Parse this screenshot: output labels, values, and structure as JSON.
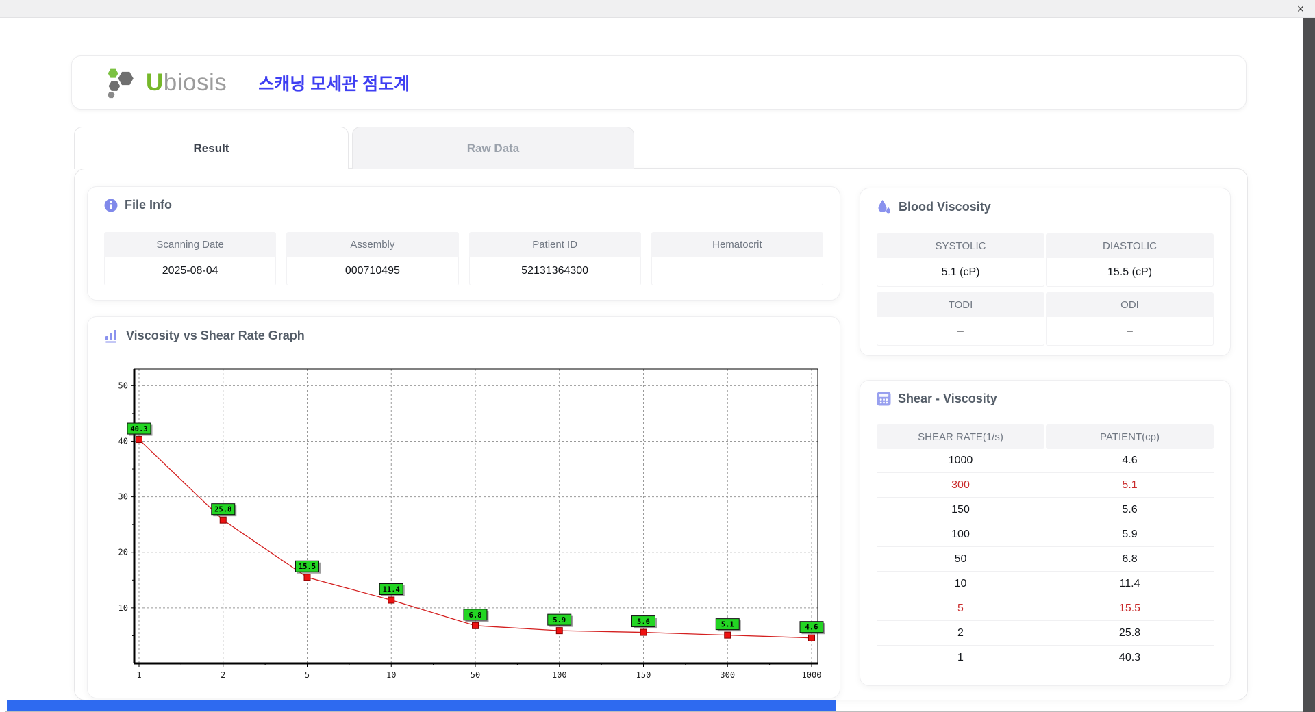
{
  "window": {
    "close_glyph": "×"
  },
  "header": {
    "brand_u": "U",
    "brand_rest": "biosis",
    "app_title": "스캐닝 모세관 점도계"
  },
  "tabs": [
    {
      "label": "Result",
      "active": true
    },
    {
      "label": "Raw Data",
      "active": false
    }
  ],
  "file_info": {
    "title": "File Info",
    "fields": [
      {
        "label": "Scanning Date",
        "value": "2025-08-04"
      },
      {
        "label": "Assembly",
        "value": "000710495"
      },
      {
        "label": "Patient ID",
        "value": "52131364300"
      },
      {
        "label": "Hematocrit",
        "value": ""
      }
    ]
  },
  "blood_viscosity": {
    "title": "Blood Viscosity",
    "rows": [
      {
        "cells": [
          {
            "label": "SYSTOLIC",
            "value": "5.1 (cP)"
          },
          {
            "label": "DIASTOLIC",
            "value": "15.5 (cP)"
          }
        ]
      },
      {
        "cells": [
          {
            "label": "TODI",
            "value": "–"
          },
          {
            "label": "ODI",
            "value": "–"
          }
        ]
      }
    ]
  },
  "shear_viscosity": {
    "title": "Shear - Viscosity",
    "columns": [
      "SHEAR RATE(1/s)",
      "PATIENT(cp)"
    ],
    "rows": [
      {
        "shear_rate": "1000",
        "patient": "4.6",
        "highlight": false
      },
      {
        "shear_rate": "300",
        "patient": "5.1",
        "highlight": true
      },
      {
        "shear_rate": "150",
        "patient": "5.6",
        "highlight": false
      },
      {
        "shear_rate": "100",
        "patient": "5.9",
        "highlight": false
      },
      {
        "shear_rate": "50",
        "patient": "6.8",
        "highlight": false
      },
      {
        "shear_rate": "10",
        "patient": "11.4",
        "highlight": false
      },
      {
        "shear_rate": "5",
        "patient": "15.5",
        "highlight": true
      },
      {
        "shear_rate": "2",
        "patient": "25.8",
        "highlight": false
      },
      {
        "shear_rate": "1",
        "patient": "40.3",
        "highlight": false
      }
    ]
  },
  "chart_data": {
    "type": "line",
    "title": "Viscosity vs Shear Rate Graph",
    "xlabel": "",
    "ylabel": "",
    "x_categories": [
      "1",
      "2",
      "5",
      "10",
      "50",
      "100",
      "150",
      "300",
      "1000"
    ],
    "series": [
      {
        "name": "PATIENT(cp)",
        "values": [
          40.3,
          25.8,
          15.5,
          11.4,
          6.8,
          5.9,
          5.6,
          5.1,
          4.6
        ]
      }
    ],
    "point_labels": [
      "40.3",
      "25.8",
      "15.5",
      "11.4",
      "6.8",
      "5.9",
      "5.6",
      "5.1",
      "4.6"
    ],
    "ylim": [
      0,
      53
    ],
    "yticks": [
      10,
      20,
      30,
      40,
      50
    ],
    "x_axis_scale": "categorical (log-spaced shear rates)",
    "grid": true,
    "legend": "none",
    "line_color": "#d42020",
    "marker_color": "#ee1212",
    "marker_stroke": "#8a0000",
    "label_bg": "#23d523",
    "label_text_color": "#000000"
  },
  "colors": {
    "accent_indigo": "#8a92ee",
    "title_blue": "#3e3ef2",
    "brand_green": "#76b82a",
    "brand_gray": "#9c9c9c",
    "highlight_red": "#c92a2a",
    "bottom_bar_blue": "#2e6af0"
  }
}
